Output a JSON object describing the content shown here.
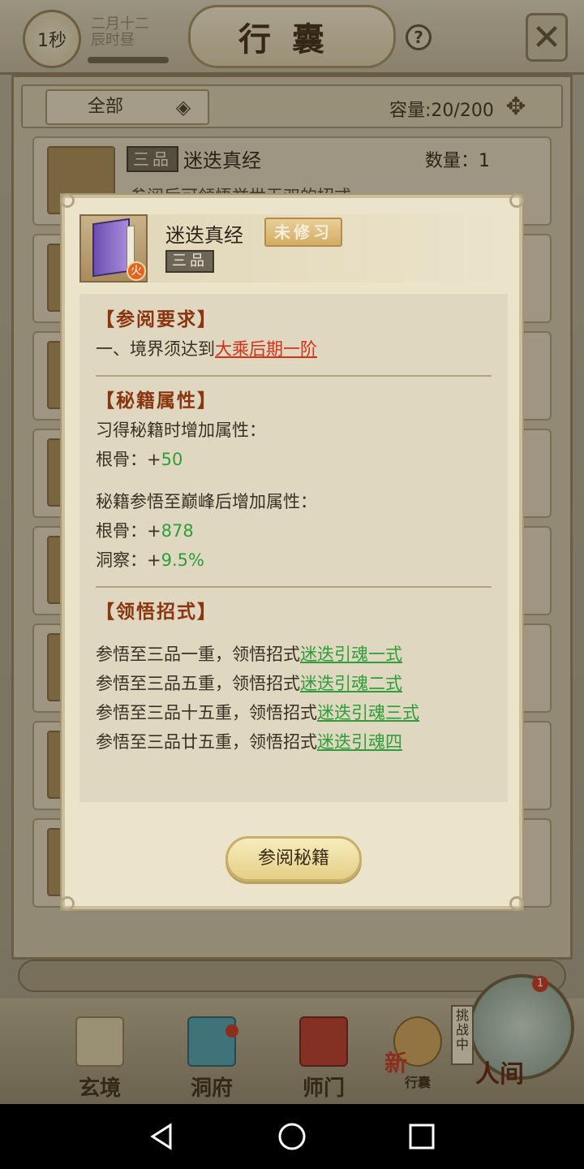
{
  "header": {
    "timer": "1秒",
    "date_line1": "二月十二",
    "date_line2": "辰时昼",
    "title": "行囊"
  },
  "toolbar": {
    "filter": "全部",
    "capacity": "容量:20/200"
  },
  "list": {
    "first_item": {
      "grade": "三品",
      "name": "迷迭真经",
      "quantity": "数量：1",
      "desc": "参阅后可领悟举世无双的招式"
    }
  },
  "dialog": {
    "name": "迷迭真经",
    "status": "未修习",
    "grade": "三品",
    "icon_badge": "火",
    "req_title": "【参阅要求】",
    "req_prefix": "一、境界须达到",
    "req_value": "大乘后期一阶",
    "attr_title": "【秘籍属性】",
    "attr_learn_label": "习得秘籍时增加属性：",
    "attr1_name": "根骨：+",
    "attr1_value": "50",
    "attr_peak_label": "秘籍参悟至巅峰后增加属性：",
    "attr2_name": "根骨：+",
    "attr2_value": "878",
    "attr3_name": "洞察：+",
    "attr3_value": "9.5%",
    "move_title": "【领悟招式】",
    "moves": [
      {
        "prefix": "参悟至三品一重，领悟招式",
        "link": "迷迭引魂一式"
      },
      {
        "prefix": "参悟至三品五重，领悟招式",
        "link": "迷迭引魂二式"
      },
      {
        "prefix": "参悟至三品十五重，领悟招式",
        "link": "迷迭引魂三式"
      },
      {
        "prefix": "参悟至三品廿五重，领悟招式",
        "link": "迷迭引魂四"
      }
    ],
    "button": "参阅秘籍"
  },
  "nav": {
    "items": [
      "玄境",
      "洞府",
      "师门",
      "行囊"
    ],
    "new_tag": "新",
    "challenge": "挑战中",
    "world": "人间",
    "world_badge": "1"
  },
  "colors": {
    "section_title": "#8a3510",
    "red_link": "#d2321a",
    "green_value": "#2e9e3a"
  }
}
